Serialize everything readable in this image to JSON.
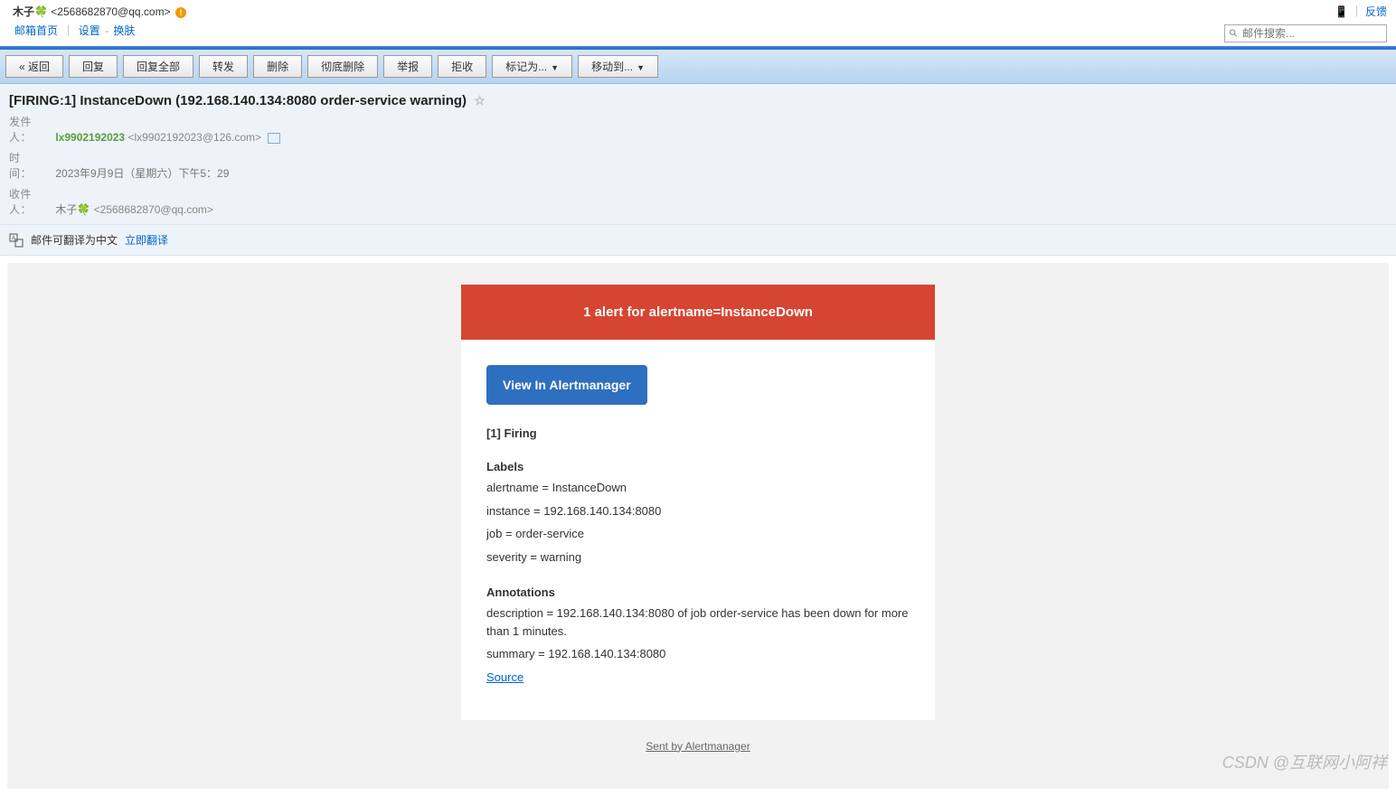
{
  "header": {
    "user_display": "木子🍀",
    "user_email": "<2568682870@qq.com>",
    "alert_badge": "!",
    "links": {
      "home": "邮箱首页",
      "settings": "设置",
      "skin": "换肤"
    },
    "right": {
      "mobile": "📱",
      "feedback": "反馈"
    },
    "search_placeholder": "邮件搜索..."
  },
  "toolbar": {
    "back": "« 返回",
    "reply": "回复",
    "reply_all": "回复全部",
    "forward": "转发",
    "delete": "删除",
    "delete_forever": "彻底删除",
    "report": "举报",
    "reject": "拒收",
    "mark_as": "标记为...",
    "move_to": "移动到..."
  },
  "mail": {
    "subject": "[FIRING:1] InstanceDown (192.168.140.134:8080 order-service warning)",
    "from_label": "发件人：",
    "from_name": "lx9902192023",
    "from_addr": "<lx9902192023@126.com>",
    "time_label": "时　间：",
    "time_value": "2023年9月9日（星期六）下午5：29",
    "to_label": "收件人：",
    "to_name": "木子🍀",
    "to_addr": "<2568682870@qq.com>"
  },
  "translate": {
    "text": "邮件可翻译为中文",
    "link": "立即翻译"
  },
  "alert": {
    "banner": "1 alert for alertname=InstanceDown",
    "view_btn": "View In Alertmanager",
    "firing": "[1] Firing",
    "labels_title": "Labels",
    "labels": {
      "alertname": "alertname = InstanceDown",
      "instance": "instance = 192.168.140.134:8080",
      "job": "job = order-service",
      "severity": "severity = warning"
    },
    "annotations_title": "Annotations",
    "annotations": {
      "description": "description = 192.168.140.134:8080 of job order-service has been down for more than 1 minutes.",
      "summary": "summary = 192.168.140.134:8080"
    },
    "source": "Source",
    "sent_by": "Sent by Alertmanager"
  },
  "watermark": "CSDN @互联网小阿祥"
}
